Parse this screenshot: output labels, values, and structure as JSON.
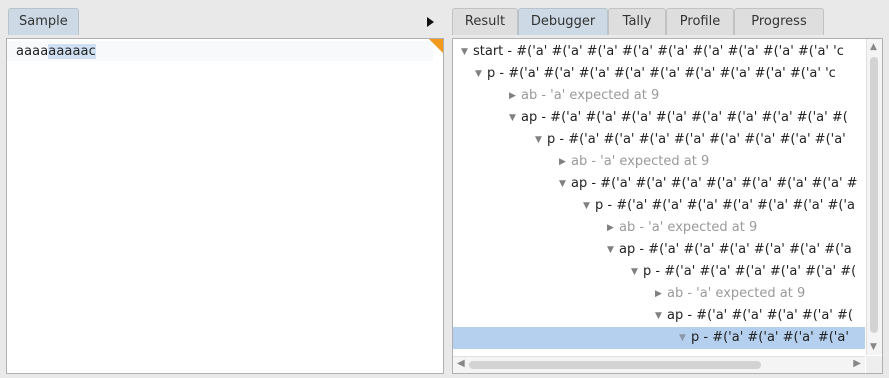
{
  "left": {
    "tab_label": "Sample",
    "editor": {
      "text_unselected": "aaaa",
      "text_selected": "aaaaac"
    }
  },
  "right": {
    "tabs": [
      {
        "label": "Result",
        "active": false
      },
      {
        "label": "Debugger",
        "active": true
      },
      {
        "label": "Tally",
        "active": false
      },
      {
        "label": "Profile",
        "active": false
      },
      {
        "label": "Progress",
        "active": false
      }
    ],
    "tree": [
      {
        "text": "start - #('a' #('a' #('a' #('a' #('a' #('a' #('a' #('a' #('a' 'c",
        "expanded": true,
        "muted": false,
        "selected": false
      },
      {
        "text": "p - #('a' #('a' #('a' #('a' #('a' #('a' #('a' #('a' #('a' 'c",
        "expanded": true,
        "muted": false,
        "selected": false
      },
      {
        "text": "ab - 'a' expected at 9",
        "expanded": false,
        "muted": true,
        "selected": false
      },
      {
        "text": "ap - #('a' #('a' #('a' #('a' #('a' #('a' #('a' #('a' #(",
        "expanded": true,
        "muted": false,
        "selected": false
      },
      {
        "text": "p - #('a' #('a' #('a' #('a' #('a' #('a' #('a' #('a'",
        "expanded": true,
        "muted": false,
        "selected": false
      },
      {
        "text": "ab - 'a' expected at 9",
        "expanded": false,
        "muted": true,
        "selected": false
      },
      {
        "text": "ap - #('a' #('a' #('a' #('a' #('a' #('a' #('a' #",
        "expanded": true,
        "muted": false,
        "selected": false
      },
      {
        "text": "p - #('a' #('a' #('a' #('a' #('a' #('a' #('a",
        "expanded": true,
        "muted": false,
        "selected": false
      },
      {
        "text": "ab - 'a' expected at 9",
        "expanded": false,
        "muted": true,
        "selected": false
      },
      {
        "text": "ap - #('a' #('a' #('a' #('a' #('a' #('a",
        "expanded": true,
        "muted": false,
        "selected": false
      },
      {
        "text": "p - #('a' #('a' #('a' #('a' #('a' #(",
        "expanded": true,
        "muted": false,
        "selected": false
      },
      {
        "text": "ab - 'a' expected at 9",
        "expanded": false,
        "muted": true,
        "selected": false
      },
      {
        "text": "ap - #('a' #('a' #('a' #('a' #(",
        "expanded": true,
        "muted": false,
        "selected": false
      },
      {
        "text": "p - #('a' #('a' #('a' #('a'",
        "expanded": true,
        "muted": false,
        "selected": true
      }
    ]
  },
  "colors": {
    "accent": "#f39a1c",
    "selection": "#b5d0ef",
    "active_tab": "#cdd9e4"
  }
}
